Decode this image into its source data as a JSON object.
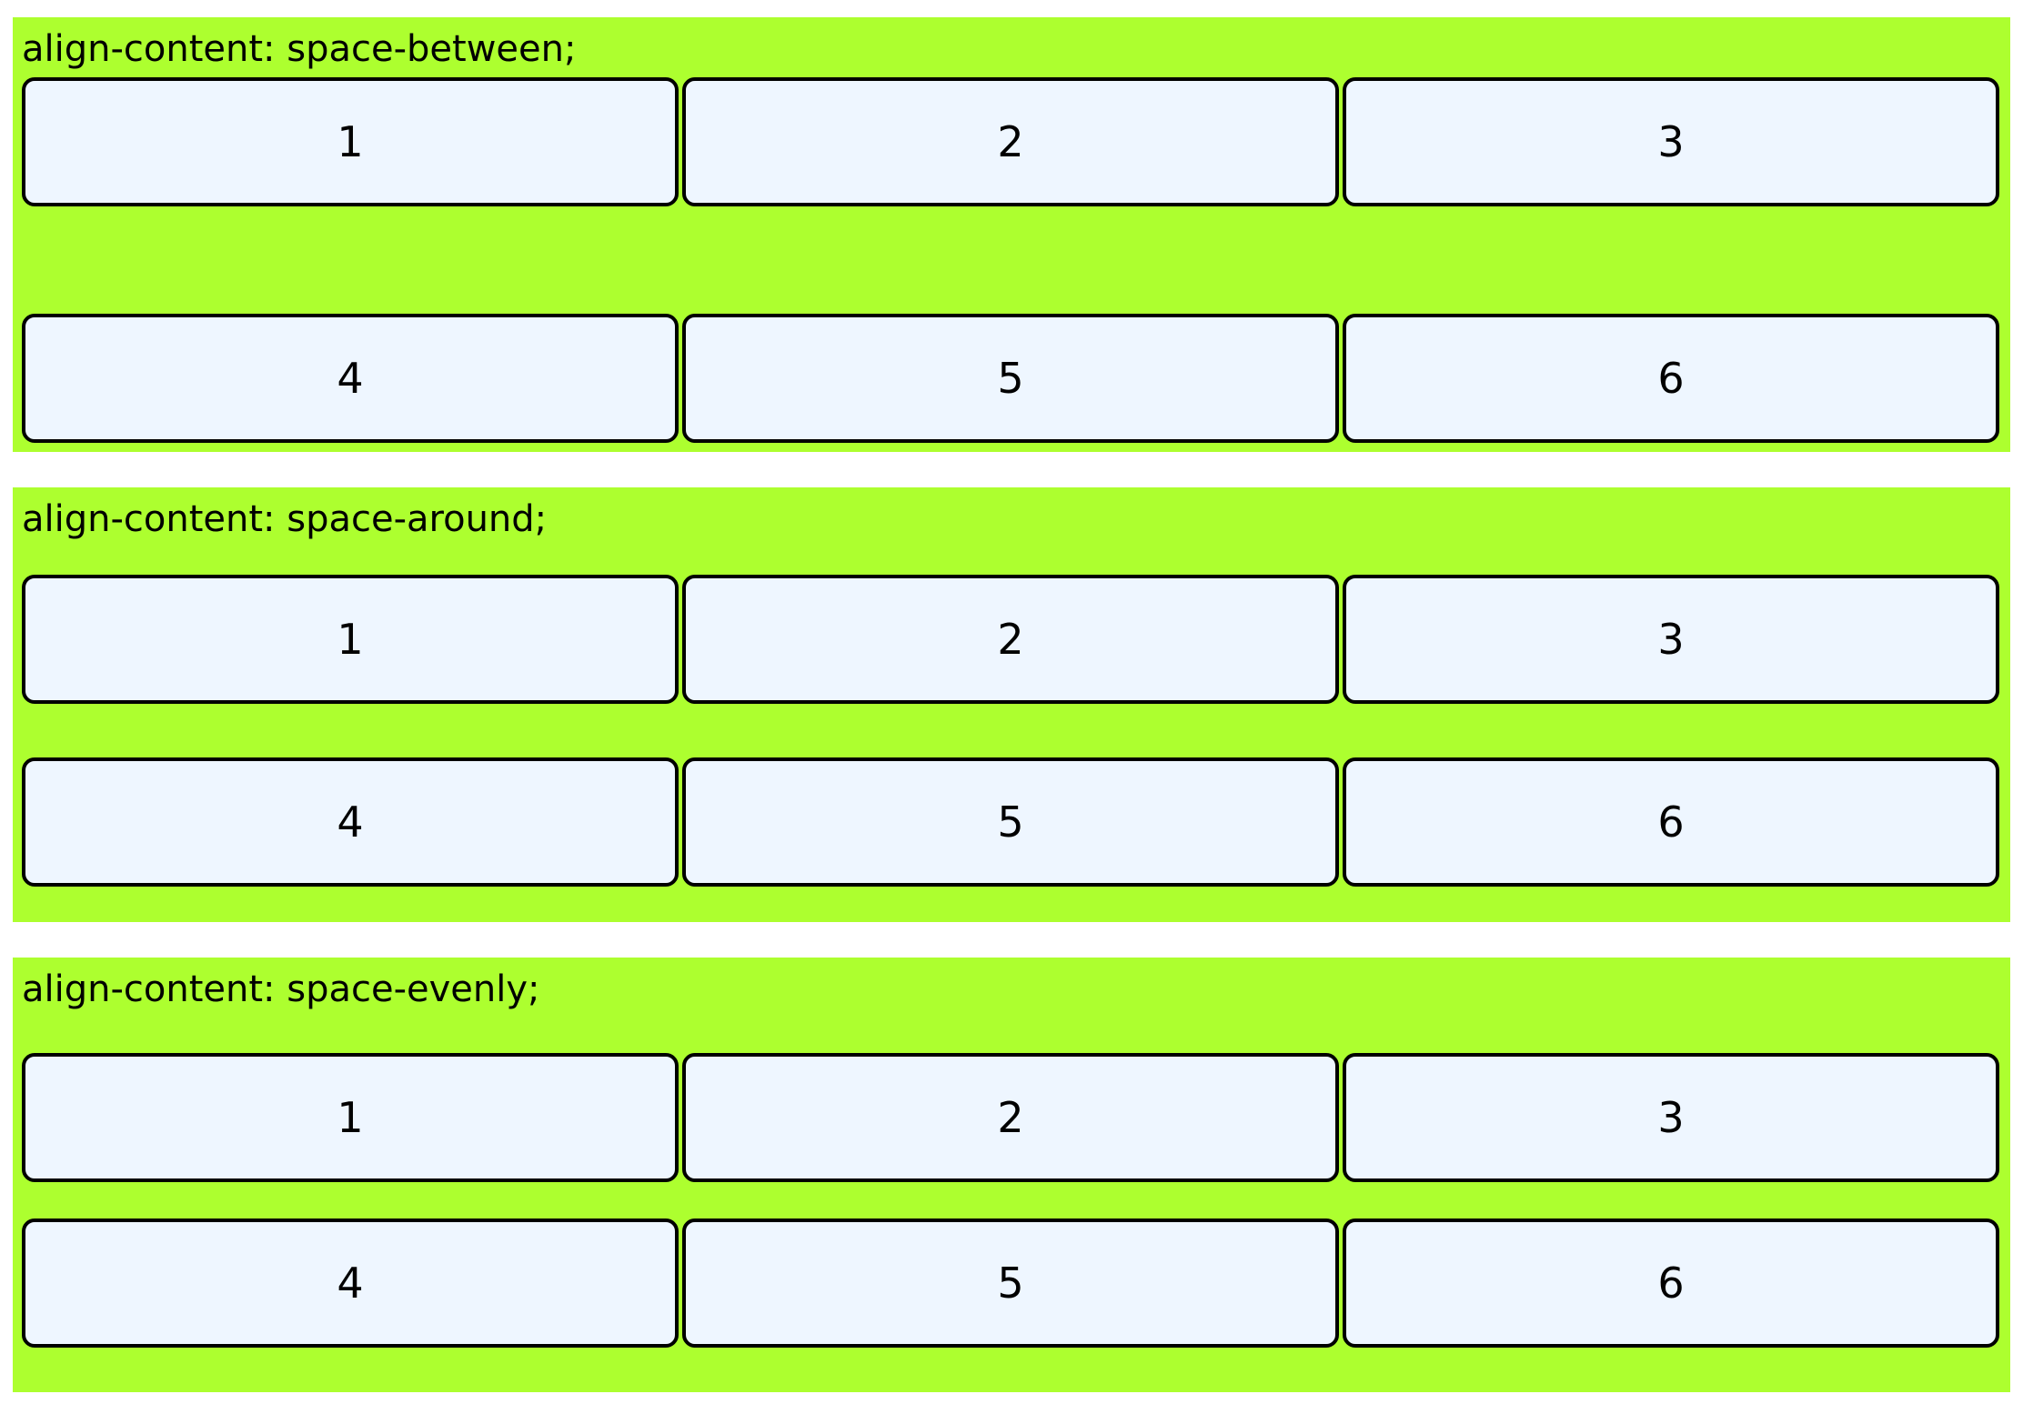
{
  "colors": {
    "panel_background": "#adff2f",
    "item_background": "#eef6ff",
    "item_border": "#000000"
  },
  "panels": [
    {
      "label": "align-content: space-between;",
      "items": [
        "1",
        "2",
        "3",
        "4",
        "5",
        "6"
      ]
    },
    {
      "label": "align-content: space-around;",
      "items": [
        "1",
        "2",
        "3",
        "4",
        "5",
        "6"
      ]
    },
    {
      "label": "align-content: space-evenly;",
      "items": [
        "1",
        "2",
        "3",
        "4",
        "5",
        "6"
      ]
    }
  ]
}
